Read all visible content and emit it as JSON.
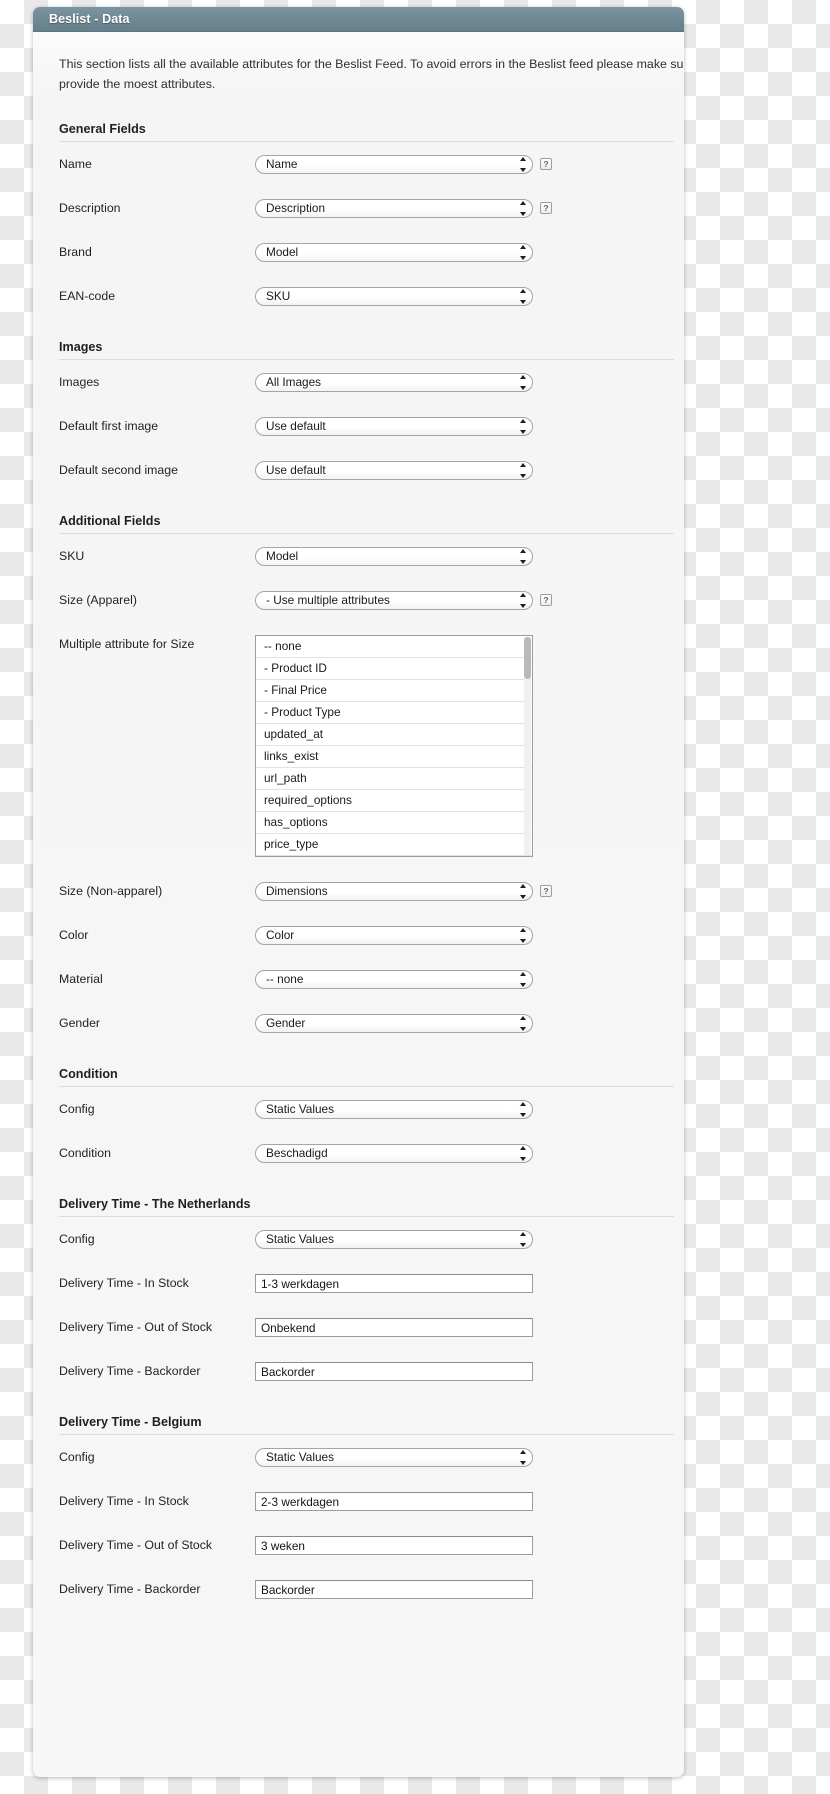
{
  "window": {
    "title": "Beslist - Data",
    "header_color": "#6f8a96"
  },
  "intro": {
    "line1": "This section lists all the available attributes for the Beslist Feed. To avoid errors in the Beslist feed please make sure that",
    "line2": "provide the moest attributes."
  },
  "sections": [
    {
      "heading": "General Fields",
      "rows": [
        {
          "label": "Name",
          "type": "select",
          "value": "Name",
          "help": true
        },
        {
          "label": "Description",
          "type": "select",
          "value": "Description",
          "help": true
        },
        {
          "label": "Brand",
          "type": "select",
          "value": "Model",
          "help": false
        },
        {
          "label": "EAN-code",
          "type": "select",
          "value": "SKU",
          "help": false
        }
      ]
    },
    {
      "heading": "Images",
      "rows": [
        {
          "label": "Images",
          "type": "select",
          "value": "All Images",
          "help": false
        },
        {
          "label": "Default first image",
          "type": "select",
          "value": "Use default",
          "help": false
        },
        {
          "label": "Default second image",
          "type": "select",
          "value": "Use default",
          "help": false
        }
      ]
    },
    {
      "heading": "Additional Fields",
      "rows": [
        {
          "label": "SKU",
          "type": "select",
          "value": "Model",
          "help": false
        },
        {
          "label": "Size (Apparel)",
          "type": "select",
          "value": "- Use multiple attributes",
          "help": true
        },
        {
          "label": "Multiple attribute for Size",
          "type": "listbox",
          "options": [
            "-- none",
            "- Product ID",
            "- Final Price",
            "- Product Type",
            "updated_at",
            "links_exist",
            "url_path",
            "required_options",
            "has_options",
            "price_type"
          ]
        },
        {
          "label": "Size (Non-apparel)",
          "type": "select",
          "value": "Dimensions",
          "help": true
        },
        {
          "label": "Color",
          "type": "select",
          "value": "Color",
          "help": false
        },
        {
          "label": "Material",
          "type": "select",
          "value": "-- none",
          "help": false
        },
        {
          "label": "Gender",
          "type": "select",
          "value": "Gender",
          "help": false
        }
      ]
    },
    {
      "heading": "Condition",
      "rows": [
        {
          "label": "Config",
          "type": "select",
          "value": "Static Values",
          "help": false
        },
        {
          "label": "Condition",
          "type": "select",
          "value": "Beschadigd",
          "help": false
        }
      ]
    },
    {
      "heading": "Delivery Time - The Netherlands",
      "rows": [
        {
          "label": "Config",
          "type": "select",
          "value": "Static Values",
          "help": false
        },
        {
          "label": "Delivery Time - In Stock",
          "type": "text",
          "value": "1-3 werkdagen"
        },
        {
          "label": "Delivery Time - Out of Stock",
          "type": "text",
          "value": "Onbekend"
        },
        {
          "label": "Delivery Time - Backorder",
          "type": "text",
          "value": "Backorder"
        }
      ]
    },
    {
      "heading": "Delivery Time - Belgium",
      "rows": [
        {
          "label": "Config",
          "type": "select",
          "value": "Static Values",
          "help": false
        },
        {
          "label": "Delivery Time - In Stock",
          "type": "text",
          "value": "2-3 werkdagen"
        },
        {
          "label": "Delivery Time - Out of Stock",
          "type": "text",
          "value": "3 weken"
        },
        {
          "label": "Delivery Time - Backorder",
          "type": "text",
          "value": "Backorder"
        }
      ]
    }
  ],
  "icons": {
    "help": "?",
    "select_arrows": "updown-arrows-icon"
  }
}
